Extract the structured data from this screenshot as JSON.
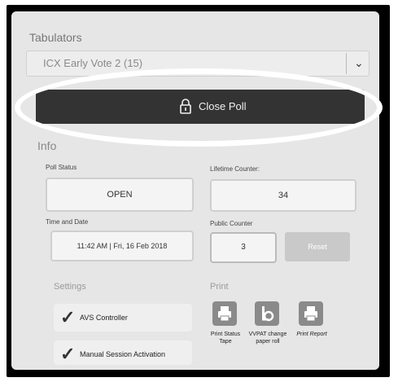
{
  "tabulators": {
    "label": "Tabulators",
    "selected": "ICX Early Vote 2 (15)",
    "chevron": "chevron-down-icon"
  },
  "close_poll": {
    "label": "Close Poll",
    "icon": "lock-icon"
  },
  "info": {
    "label": "Info",
    "poll_status_label": "Poll Status",
    "poll_status_value": "OPEN",
    "lifetime_counter_label": "Lifetime Counter:",
    "lifetime_counter_value": "34",
    "time_date_label": "Time and Date",
    "time_date_value": "11:42 AM | Fri, 16 Feb 2018",
    "public_counter_label": "Public Counter",
    "public_counter_value": "3",
    "reset_label": "Reset"
  },
  "settings": {
    "label": "Settings",
    "items": [
      {
        "label": "AVS Controller",
        "checked": true
      },
      {
        "label": "Manual Session Activation",
        "checked": true
      }
    ]
  },
  "print": {
    "label": "Print",
    "items": [
      {
        "label_line1": "Print Status",
        "label_line2": "Tape",
        "icon": "printer-icon"
      },
      {
        "label_line1": "VVPAT change",
        "label_line2": "paper roll",
        "icon": "paper-roll-icon"
      },
      {
        "label_line1": "Print Report",
        "label_line2": "",
        "icon": "printer-icon"
      }
    ]
  }
}
